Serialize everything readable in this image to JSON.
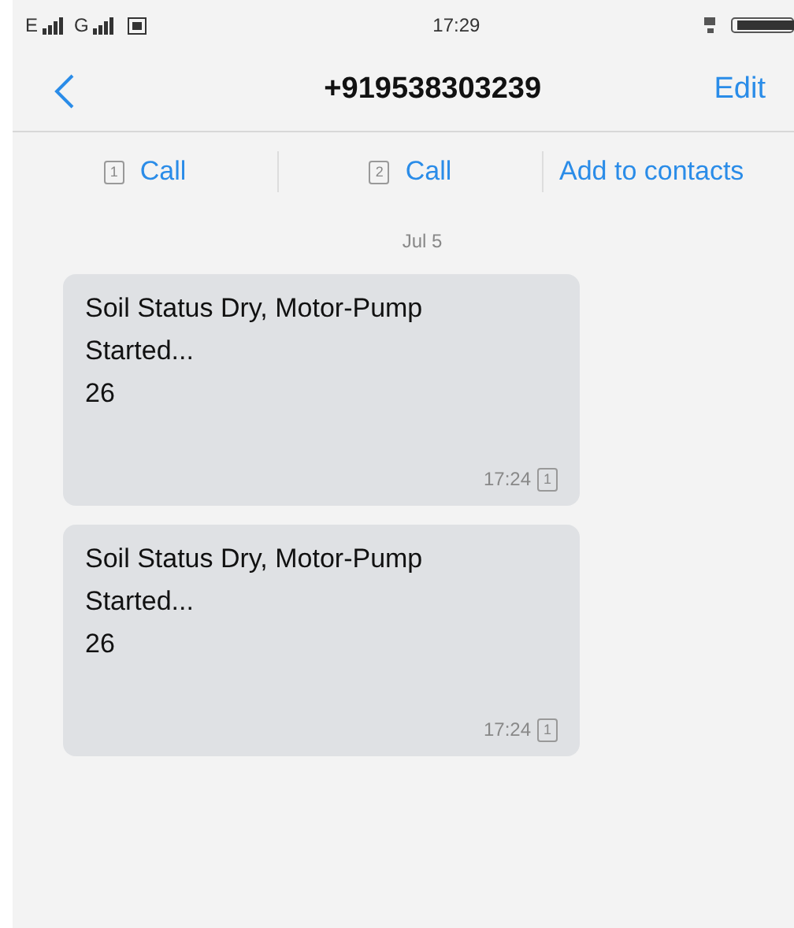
{
  "status_bar": {
    "network_1": "E",
    "network_2": "G",
    "time": "17:29"
  },
  "header": {
    "title": "+919538303239",
    "edit": "Edit"
  },
  "actions": [
    {
      "kind": "sim",
      "sim": "1",
      "label": "Call"
    },
    {
      "kind": "sim",
      "sim": "2",
      "label": "Call"
    },
    {
      "kind": "plain",
      "label": "Add to contacts"
    }
  ],
  "date": "Jul 5",
  "messages": [
    {
      "text": "Soil Status Dry, Motor-Pump Started...\n26",
      "time": "17:24",
      "sim": "1"
    },
    {
      "text": "Soil Status Dry, Motor-Pump Started...\n26",
      "time": "17:24",
      "sim": "1"
    }
  ]
}
